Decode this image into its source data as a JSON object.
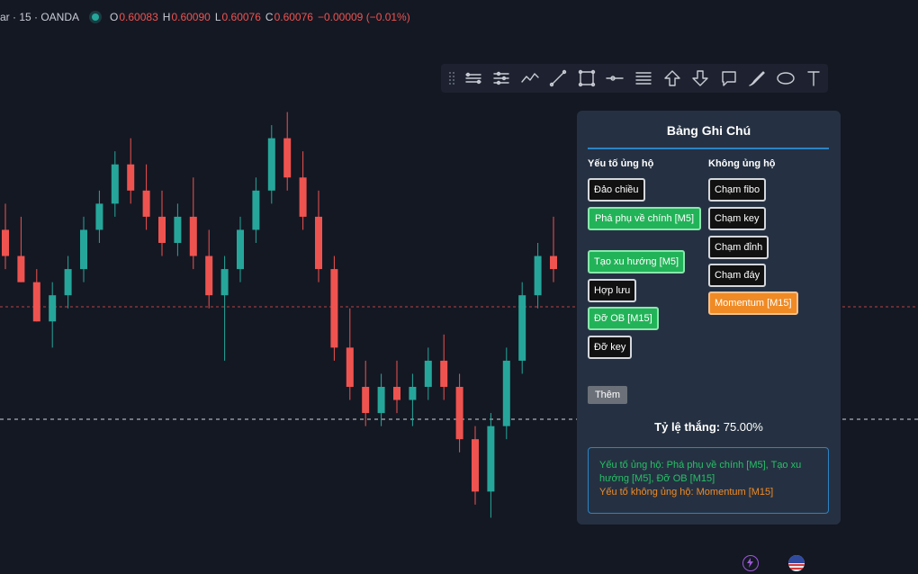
{
  "header": {
    "symbol": "ar · 15 · OANDA",
    "o_label": "O",
    "o_value": "0.60083",
    "h_label": "H",
    "h_value": "0.60090",
    "l_label": "L",
    "l_value": "0.60076",
    "c_label": "C",
    "c_value": "0.60076",
    "change": "−0.00009 (−0.01%)"
  },
  "toolbar": {
    "tools": [
      "parallel-channel-icon",
      "regression-channel-icon",
      "zigzag-icon",
      "trend-line-icon",
      "rectangle-icon",
      "horizontal-ray-icon",
      "horizontal-lines-icon",
      "arrow-up-icon",
      "arrow-down-icon",
      "comment-icon",
      "brush-icon",
      "ellipse-icon",
      "text-icon"
    ]
  },
  "panel": {
    "title": "Bảng Ghi Chú",
    "support_header": "Yếu tố ủng hộ",
    "against_header": "Không ủng hộ",
    "support_tags": [
      {
        "label": "Đảo chiều",
        "state": "off"
      },
      {
        "label": "Phá phụ về chính [M5]",
        "state": "green"
      },
      {
        "label": "Tạo xu hướng [M5]",
        "state": "green"
      },
      {
        "label": "Hợp lưu",
        "state": "off"
      },
      {
        "label": "Đỡ OB [M15]",
        "state": "green"
      },
      {
        "label": "Đỡ key",
        "state": "off"
      }
    ],
    "against_tags": [
      {
        "label": "Chạm fibo",
        "state": "off"
      },
      {
        "label": "Chạm key",
        "state": "off"
      },
      {
        "label": "Chạm đỉnh",
        "state": "off"
      },
      {
        "label": "Chạm đáy",
        "state": "off"
      },
      {
        "label": "Momentum [M15]",
        "state": "orange"
      }
    ],
    "add_button": "Thêm",
    "winrate_label": "Tỷ lệ thắng:",
    "winrate_value": "75.00%",
    "summary_pro": "Yếu tố ủng hộ: Phá phụ về chính [M5], Tạo xu hướng [M5], Đỡ OB [M15]",
    "summary_con": "Yếu tố không ủng hộ: Momentum [M15]"
  },
  "colors": {
    "background": "#141823",
    "bull": "#26a69a",
    "bear": "#ef5350",
    "panel_bg": "#253142",
    "accent_blue": "#2d83c4",
    "tag_green": "#22b358",
    "tag_orange": "#f08a24"
  },
  "chart_data": {
    "type": "candlestick",
    "candles": [
      [
        0.6008,
        0.601,
        0.6005,
        0.6006
      ],
      [
        0.6006,
        0.6009,
        0.6004,
        0.6004
      ],
      [
        0.6004,
        0.6005,
        0.6001,
        0.6001
      ],
      [
        0.6001,
        0.6004,
        0.5999,
        0.6003
      ],
      [
        0.6003,
        0.6006,
        0.6002,
        0.6005
      ],
      [
        0.6005,
        0.6009,
        0.6004,
        0.6008
      ],
      [
        0.6008,
        0.6011,
        0.6007,
        0.601
      ],
      [
        0.601,
        0.6014,
        0.6009,
        0.6013
      ],
      [
        0.6013,
        0.6015,
        0.601,
        0.6011
      ],
      [
        0.6011,
        0.6013,
        0.6008,
        0.6009
      ],
      [
        0.6009,
        0.6011,
        0.6006,
        0.6007
      ],
      [
        0.6007,
        0.601,
        0.6006,
        0.6009
      ],
      [
        0.6009,
        0.6012,
        0.6005,
        0.6006
      ],
      [
        0.6006,
        0.6008,
        0.6002,
        0.6003
      ],
      [
        0.6003,
        0.6006,
        0.5998,
        0.6005
      ],
      [
        0.6005,
        0.6009,
        0.6004,
        0.6008
      ],
      [
        0.6008,
        0.6012,
        0.6007,
        0.6011
      ],
      [
        0.6011,
        0.6016,
        0.601,
        0.6015
      ],
      [
        0.6015,
        0.6017,
        0.6011,
        0.6012
      ],
      [
        0.6012,
        0.6014,
        0.6008,
        0.6009
      ],
      [
        0.6009,
        0.6011,
        0.6004,
        0.6005
      ],
      [
        0.6005,
        0.6006,
        0.5998,
        0.5999
      ],
      [
        0.5999,
        0.6002,
        0.5995,
        0.5996
      ],
      [
        0.5996,
        0.5998,
        0.5993,
        0.5994
      ],
      [
        0.5994,
        0.5997,
        0.5993,
        0.5996
      ],
      [
        0.5996,
        0.5998,
        0.5994,
        0.5995
      ],
      [
        0.5995,
        0.5997,
        0.5993,
        0.5996
      ],
      [
        0.5996,
        0.5999,
        0.5995,
        0.5998
      ],
      [
        0.5998,
        0.6,
        0.5995,
        0.5996
      ],
      [
        0.5996,
        0.5997,
        0.5991,
        0.5992
      ],
      [
        0.5992,
        0.5993,
        0.5987,
        0.5988
      ],
      [
        0.5988,
        0.5994,
        0.5986,
        0.5993
      ],
      [
        0.5993,
        0.5999,
        0.5992,
        0.5998
      ],
      [
        0.5998,
        0.6004,
        0.5997,
        0.6003
      ],
      [
        0.6003,
        0.6007,
        0.6002,
        0.6006
      ],
      [
        0.6006,
        0.6009,
        0.6004,
        0.6005
      ]
    ],
    "reference_lines": [
      0.6005,
      0.5994
    ],
    "grid": false
  }
}
